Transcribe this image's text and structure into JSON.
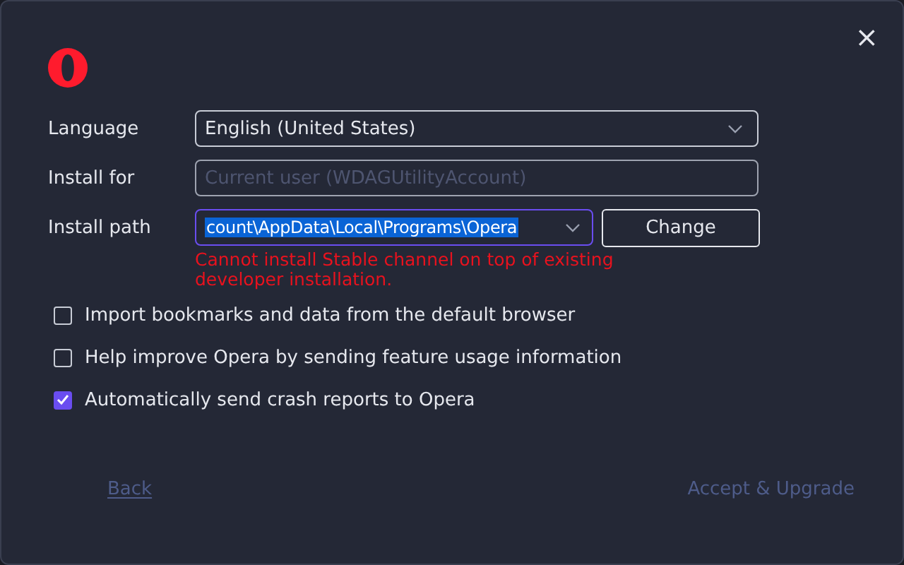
{
  "window": {
    "close": "×"
  },
  "fields": [
    {
      "kind": "select",
      "label": "Language",
      "value": "English (United States)",
      "disabled": false
    },
    {
      "kind": "select",
      "label": "Install for",
      "value": "Current user (WDAGUtilityAccount)",
      "disabled": true
    },
    {
      "kind": "path",
      "label": "Install path",
      "value": "count\\AppData\\Local\\Programs\\Opera",
      "disabled": false,
      "button": "Change"
    }
  ],
  "error": "Cannot install Stable channel on top of existing developer installation.",
  "checkboxes": [
    {
      "label": "Import bookmarks and data from the default browser",
      "checked": false
    },
    {
      "label": "Help improve Opera by sending feature usage information",
      "checked": false
    },
    {
      "label": "Automatically send crash reports to Opera",
      "checked": true
    }
  ],
  "footer": {
    "back": {
      "label": "Back",
      "disabled": true
    },
    "accept": {
      "label": "Accept & Upgrade",
      "disabled": true
    }
  }
}
